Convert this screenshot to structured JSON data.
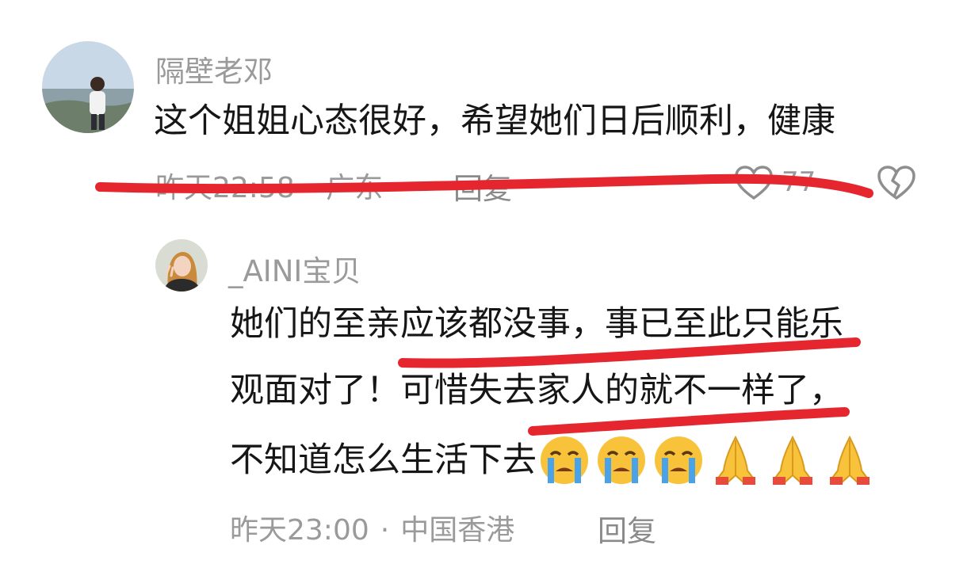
{
  "comments": [
    {
      "author": "隔壁老邓",
      "text": "这个姐姐心态很好，希望她们日后顺利，健康",
      "time": "昨天22:58",
      "location": "广东",
      "reply_label": "回复",
      "like_count": "77",
      "icons": [
        "heart-icon",
        "broken-heart-icon"
      ],
      "replies": [
        {
          "author": "_AINI宝贝",
          "text_lines": [
            "她们的至亲应该都没事，事已至此只能乐",
            "观面对了！可惜失去家人的就不一样了，",
            "不知道怎么生活下去"
          ],
          "emojis": [
            "loudly-crying-face",
            "loudly-crying-face",
            "loudly-crying-face",
            "folded-hands",
            "folded-hands",
            "folded-hands"
          ],
          "time": "昨天23:00",
          "location": "中国香港",
          "reply_label": "回复"
        }
      ]
    }
  ],
  "colors": {
    "text": "#161616",
    "meta": "#9a9a9a",
    "strike_red": "#e5262f",
    "emoji_yellow": "#f8c23a",
    "tears_blue": "#4aa3e8"
  }
}
